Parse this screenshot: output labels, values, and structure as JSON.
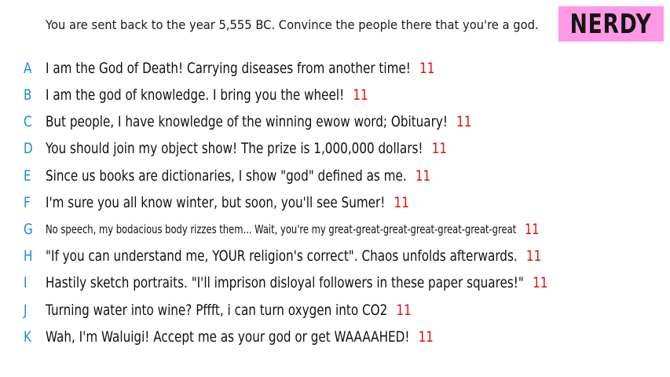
{
  "prompt": "You are sent back to the year 5,555 BC. Convince the people there that you're a god.",
  "badge": "NERDY",
  "answers": [
    {
      "letter": "A",
      "text": "I am the God of Death! Carrying diseases from another time!",
      "score": "11"
    },
    {
      "letter": "B",
      "text": "I am the god of knowledge. I bring you the wheel!",
      "score": "11"
    },
    {
      "letter": "C",
      "text": "But people, I have knowledge of the winning ewow word; Obituary!",
      "score": "11"
    },
    {
      "letter": "D",
      "text": "You should join my object show! The prize is 1,000,000 dollars!",
      "score": "11"
    },
    {
      "letter": "E",
      "text": "Since us books are dictionaries, I show \"god\" defined as me.",
      "score": "11"
    },
    {
      "letter": "F",
      "text": "I'm sure you all know winter, but soon, you'll see Sumer!",
      "score": "11"
    },
    {
      "letter": "G",
      "text": "No speech, my bodacious body rizzes them... Wait, you're my great-great-great-great-great-great-great",
      "score": "11"
    },
    {
      "letter": "H",
      "text": "\"If you can understand me, YOUR religion's correct\". Chaos unfolds afterwards.",
      "score": "11"
    },
    {
      "letter": "I",
      "text": "Hastily sketch portraits. \"I'll imprison disloyal followers in these paper squares!\"",
      "score": "11"
    },
    {
      "letter": "J",
      "text": "Turning water into wine? Pffft, i can turn oxygen into CO2",
      "score": "11"
    },
    {
      "letter": "K",
      "text": "Wah, I'm Waluigi! Accept me as your god or get WAAAAHED!",
      "score": "11"
    }
  ]
}
